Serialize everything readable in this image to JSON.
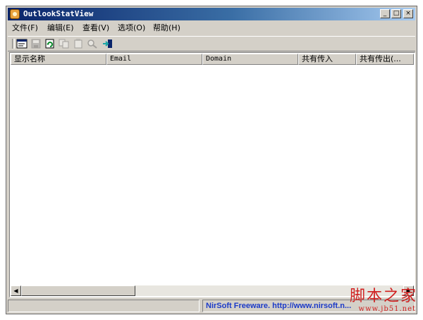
{
  "window": {
    "title": "OutlookStatView",
    "controls": {
      "minimize": "_",
      "maximize": "□",
      "close": "×"
    }
  },
  "menu": [
    {
      "label": "文件(F)"
    },
    {
      "label": "编辑(E)"
    },
    {
      "label": "查看(V)"
    },
    {
      "label": "选项(O)"
    },
    {
      "label": "帮助(H)"
    }
  ],
  "toolbar": {
    "buttons": [
      {
        "name": "properties-icon",
        "enabled": true
      },
      {
        "name": "save-icon",
        "enabled": false
      },
      {
        "name": "refresh-icon",
        "enabled": true
      },
      {
        "name": "copy-icon",
        "enabled": false
      },
      {
        "name": "report-icon",
        "enabled": false
      },
      {
        "name": "find-icon",
        "enabled": false
      },
      {
        "name": "exit-icon",
        "enabled": true
      }
    ]
  },
  "list": {
    "columns": [
      "显示名称",
      "Email",
      "Domain",
      "共有传入",
      "共有传出(..."
    ],
    "rows": []
  },
  "statusbar": {
    "left": "",
    "right": "NirSoft Freeware.  http://www.nirsoft.n..."
  },
  "watermark": {
    "chinese": "脚本之家",
    "url": "www.jb51.net"
  },
  "colors": {
    "titlebar_start": "#0a246a",
    "titlebar_end": "#a6caf0",
    "face": "#d4d0c8",
    "link": "#1b3ac8",
    "watermark": "#d02020"
  }
}
